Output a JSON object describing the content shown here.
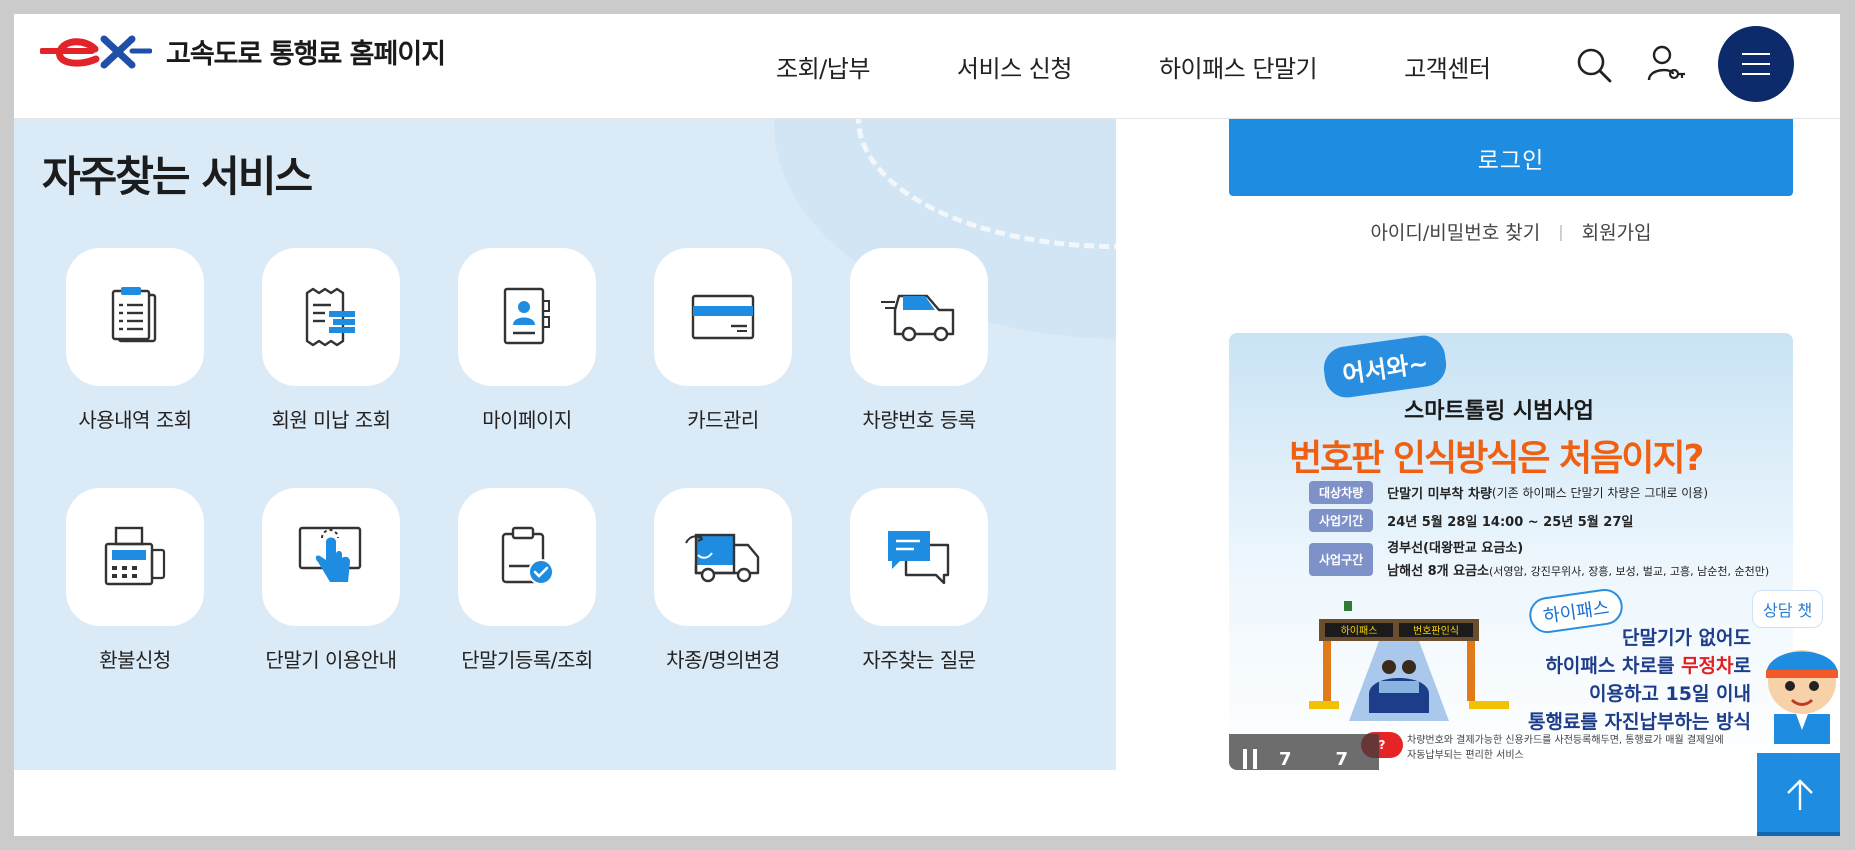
{
  "header": {
    "logo_mark": "ex",
    "site_title": "고속도로 통행료 홈페이지",
    "nav": [
      "조회/납부",
      "서비스 신청",
      "하이패스 단말기",
      "고객센터"
    ],
    "icons": [
      "search-icon",
      "user-key-icon",
      "hamburger-menu-icon"
    ],
    "colors": {
      "brand_red": "#e2232a",
      "brand_blue": "#1f4fa8",
      "menu_bg": "#0d2b6b"
    }
  },
  "services": {
    "title": "자주찾는 서비스",
    "items": [
      {
        "label": "사용내역 조회",
        "icon": "document-list-icon"
      },
      {
        "label": "회원 미납 조회",
        "icon": "receipt-icon"
      },
      {
        "label": "마이페이지",
        "icon": "contact-book-icon"
      },
      {
        "label": "카드관리",
        "icon": "credit-card-icon"
      },
      {
        "label": "차량번호 등록",
        "icon": "moving-car-icon"
      },
      {
        "label": "환불신청",
        "icon": "fax-machine-icon"
      },
      {
        "label": "단말기 이용안내",
        "icon": "touch-screen-icon"
      },
      {
        "label": "단말기등록/조회",
        "icon": "clipboard-check-icon"
      },
      {
        "label": "차종/명의변경",
        "icon": "truck-exchange-icon"
      },
      {
        "label": "자주찾는 질문",
        "icon": "chat-bubbles-icon"
      }
    ],
    "colors": {
      "panel_bg": "#dbeaf7",
      "icon_accent": "#1e8ce0"
    }
  },
  "login": {
    "button_label": "로그인",
    "find_account": "아이디/비밀번호 찾기",
    "separator": "|",
    "signup": "회원가입",
    "color": "#1e8ce0"
  },
  "banner": {
    "welcome": "어서와~",
    "subtitle": "스마트톨링 시범사업",
    "title_part1": "번호판 인식방식",
    "title_part2": "은 처음이지?",
    "rows": [
      {
        "tag": "대상차량",
        "bold": "단말기 미부착 차량",
        "text": "(기존 하이패스 단말기 차량은 그대로 이용)"
      },
      {
        "tag": "사업기간",
        "bold": "24년 5월 28일 14:00 ~ 25년 5월 27일",
        "text": ""
      },
      {
        "tag": "사업구간",
        "bold": "경부선(대왕판교 요금소)",
        "text": ""
      }
    ],
    "row3_line2_bold": "남해선 8개 요금소",
    "row3_line2_text": "(서영암, 강진무위사, 장흥, 보성, 벌교, 고흥, 남순천, 순천만)",
    "gate_signs": [
      "하이패스",
      "번호판인식"
    ],
    "hipass_bubble": "하이패스",
    "right_lines": [
      {
        "parts": [
          {
            "t": "단말기가 없어도",
            "c": ""
          }
        ]
      },
      {
        "parts": [
          {
            "t": "하이패스 차로",
            "c": ""
          },
          {
            "t": "를 ",
            "c": ""
          },
          {
            "t": "무정차",
            "c": "red"
          },
          {
            "t": "로",
            "c": ""
          }
        ]
      },
      {
        "parts": [
          {
            "t": "이용하고 15일 이내",
            "c": ""
          }
        ]
      },
      {
        "parts": [
          {
            "t": "통행료를 자진납부",
            "c": ""
          },
          {
            "t": "하는 방식",
            "c": ""
          }
        ]
      }
    ],
    "badge": "?",
    "footer_line1": "차량번호와 결제가능한 신용카드를 사전등록해두면, 통행료가 매월 결제일에",
    "footer_line2": "자동납부되는 편리한 서비스",
    "pager_current": "7",
    "pager_total": "7"
  },
  "chat": {
    "label": "상담  챗"
  },
  "top_button": {
    "icon": "arrow-up-icon"
  }
}
